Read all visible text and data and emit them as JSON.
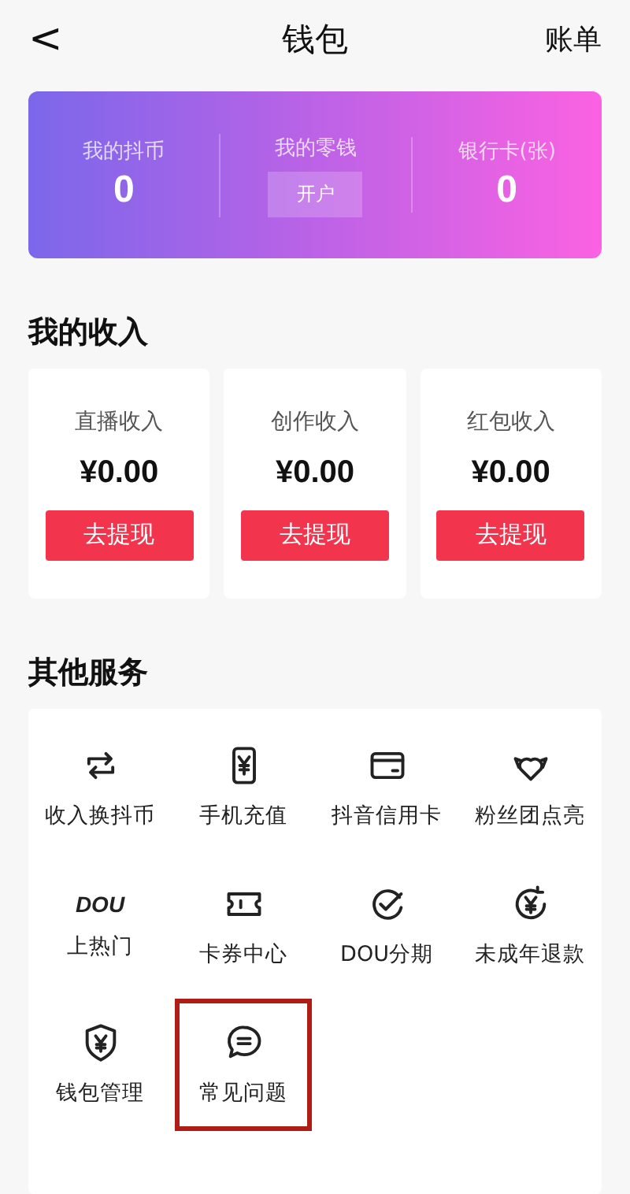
{
  "header": {
    "back": "<",
    "title": "钱包",
    "action": "账单"
  },
  "balance": [
    {
      "label": "我的抖币",
      "kind": "value",
      "value": "0"
    },
    {
      "label": "我的零钱",
      "kind": "button",
      "value": "开户"
    },
    {
      "label": "银行卡(张)",
      "kind": "value",
      "value": "0"
    }
  ],
  "income": {
    "title": "我的收入",
    "items": [
      {
        "label": "直播收入",
        "amount": "¥0.00",
        "button": "去提现"
      },
      {
        "label": "创作收入",
        "amount": "¥0.00",
        "button": "去提现"
      },
      {
        "label": "红包收入",
        "amount": "¥0.00",
        "button": "去提现"
      }
    ]
  },
  "services": {
    "title": "其他服务",
    "items": [
      {
        "label": "收入换抖币",
        "highlighted": false
      },
      {
        "label": "手机充值",
        "highlighted": false
      },
      {
        "label": "抖音信用卡",
        "highlighted": false
      },
      {
        "label": "粉丝团点亮",
        "highlighted": false
      },
      {
        "label": "上热门",
        "icon_text": "DOU",
        "highlighted": false
      },
      {
        "label": "卡券中心",
        "highlighted": false
      },
      {
        "label": "DOU分期",
        "highlighted": false
      },
      {
        "label": "未成年退款",
        "highlighted": false
      },
      {
        "label": "钱包管理",
        "highlighted": false
      },
      {
        "label": "常见问题",
        "highlighted": true
      }
    ]
  }
}
